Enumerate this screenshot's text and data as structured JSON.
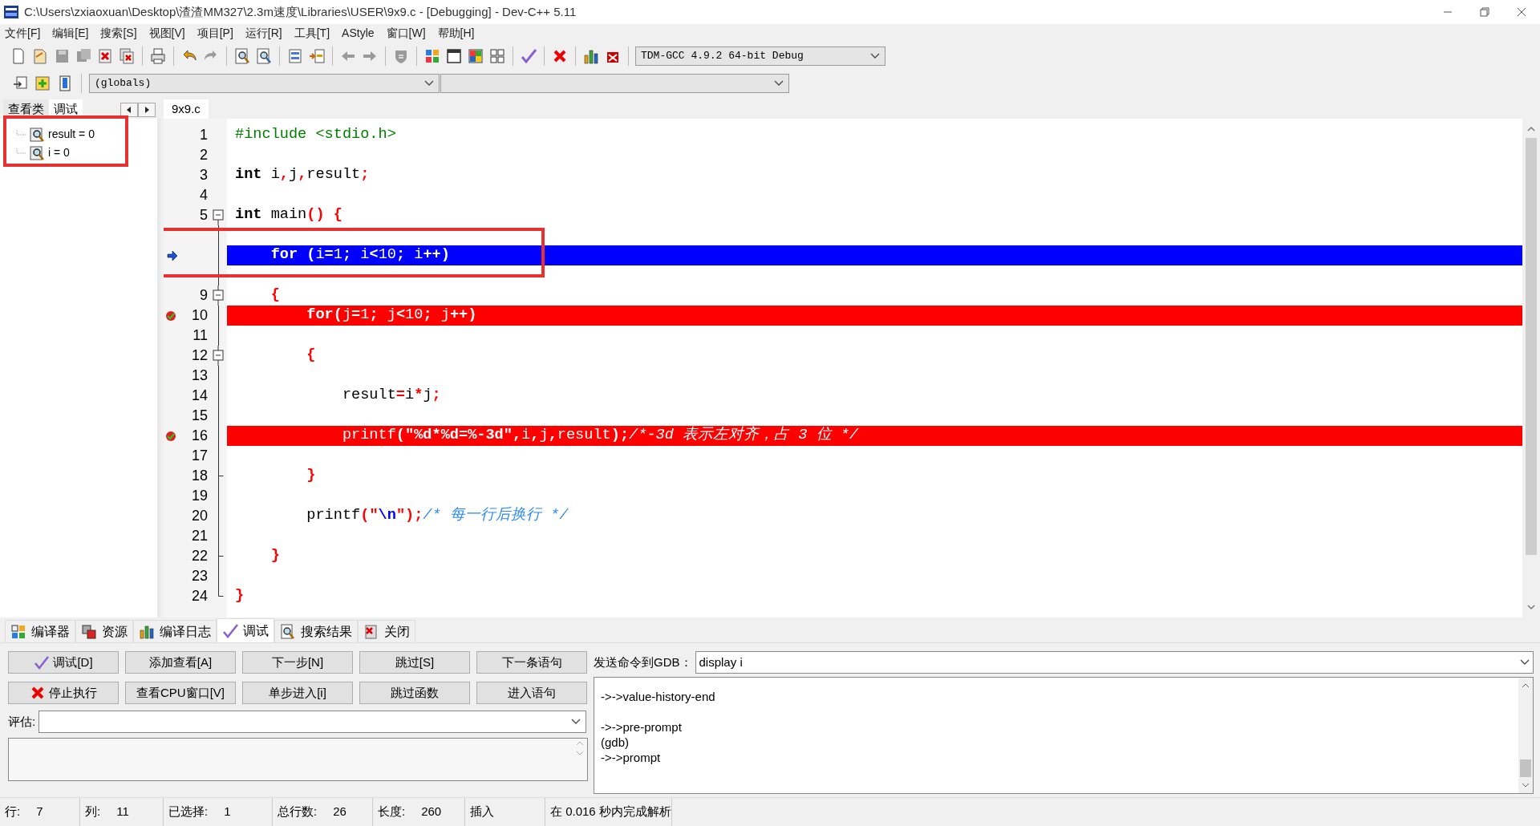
{
  "window": {
    "title": "C:\\Users\\zxiaoxuan\\Desktop\\渣渣MM327\\2.3m速度\\Libraries\\USER\\9x9.c - [Debugging] - Dev-C++ 5.11"
  },
  "menu": [
    "文件[F]",
    "编辑[E]",
    "搜索[S]",
    "视图[V]",
    "项目[P]",
    "运行[R]",
    "工具[T]",
    "AStyle",
    "窗口[W]",
    "帮助[H]"
  ],
  "toolbar": {
    "compiler": "TDM-GCC 4.9.2 64-bit Debug",
    "scope": "(globals)"
  },
  "left_panel": {
    "tabs": [
      {
        "label": "查看类",
        "selected": false
      },
      {
        "label": "调试",
        "selected": true
      }
    ],
    "watches": [
      {
        "text": "result = 0"
      },
      {
        "text": "i = 0"
      }
    ]
  },
  "editor": {
    "tabs": [
      {
        "label": "9x9.c",
        "selected": true
      }
    ],
    "lines": [
      {
        "number": "1",
        "kind": "normal",
        "fold_start": false,
        "fold_end": false,
        "segments": [
          {
            "kind": "pre",
            "text": "#include <stdio.h>"
          }
        ]
      },
      {
        "number": "2",
        "kind": "normal",
        "fold_start": false,
        "fold_end": false
      },
      {
        "number": "3",
        "kind": "normal",
        "fold_start": false,
        "fold_end": false,
        "segments": [
          {
            "kind": "kw",
            "text": "int"
          },
          {
            "kind": "plain",
            "text": " i"
          },
          {
            "kind": "sym",
            "text": ","
          },
          {
            "kind": "plain",
            "text": "j"
          },
          {
            "kind": "sym",
            "text": ","
          },
          {
            "kind": "plain",
            "text": "result"
          },
          {
            "kind": "sym",
            "text": ";"
          }
        ]
      },
      {
        "number": "4",
        "kind": "normal",
        "fold_start": false,
        "fold_end": false
      },
      {
        "number": "5",
        "kind": "normal",
        "fold_start": true,
        "fold_end": false,
        "segments": [
          {
            "kind": "kw",
            "text": "int"
          },
          {
            "kind": "plain",
            "text": " main"
          },
          {
            "kind": "sym",
            "text": "()"
          },
          {
            "kind": "sym",
            "text": " {"
          }
        ]
      },
      {
        "kind": "normal",
        "fold_start": false,
        "fold_end": false
      },
      {
        "kind": "current",
        "fold_start": false,
        "fold_end": false,
        "segments": [
          {
            "kind": "kw",
            "text": "    for"
          },
          {
            "kind": "sym",
            "text": " ("
          },
          {
            "kind": "plain",
            "text": "i"
          },
          {
            "kind": "sym",
            "text": "="
          },
          {
            "kind": "plain",
            "text": "1"
          },
          {
            "kind": "sym",
            "text": ";"
          },
          {
            "kind": "plain",
            "text": " i"
          },
          {
            "kind": "sym",
            "text": "<"
          },
          {
            "kind": "plain",
            "text": "10"
          },
          {
            "kind": "sym",
            "text": ";"
          },
          {
            "kind": "plain",
            "text": " i"
          },
          {
            "kind": "sym",
            "text": "++)"
          }
        ]
      },
      {
        "kind": "normal",
        "fold_start": false,
        "fold_end": false
      },
      {
        "number": "9",
        "kind": "normal",
        "fold_start": true,
        "fold_end": false,
        "segments": [
          {
            "kind": "sym",
            "text": "    {"
          }
        ]
      },
      {
        "number": "10",
        "kind": "breakpoint",
        "fold_start": false,
        "fold_end": false,
        "segments": [
          {
            "kind": "kw",
            "text": "        for"
          },
          {
            "kind": "sym",
            "text": "("
          },
          {
            "kind": "plain",
            "text": "j"
          },
          {
            "kind": "sym",
            "text": "="
          },
          {
            "kind": "plain",
            "text": "1"
          },
          {
            "kind": "sym",
            "text": ";"
          },
          {
            "kind": "plain",
            "text": " j"
          },
          {
            "kind": "sym",
            "text": "<"
          },
          {
            "kind": "plain",
            "text": "10"
          },
          {
            "kind": "sym",
            "text": ";"
          },
          {
            "kind": "plain",
            "text": " j"
          },
          {
            "kind": "sym",
            "text": "++)"
          }
        ]
      },
      {
        "number": "11",
        "kind": "normal",
        "fold_start": false,
        "fold_end": false
      },
      {
        "number": "12",
        "kind": "normal",
        "fold_start": true,
        "fold_end": false,
        "segments": [
          {
            "kind": "sym",
            "text": "        {"
          }
        ]
      },
      {
        "number": "13",
        "kind": "normal",
        "fold_start": false,
        "fold_end": false
      },
      {
        "number": "14",
        "kind": "normal",
        "fold_start": false,
        "fold_end": false,
        "segments": [
          {
            "kind": "plain",
            "text": "            result"
          },
          {
            "kind": "sym",
            "text": "="
          },
          {
            "kind": "plain",
            "text": "i"
          },
          {
            "kind": "sym",
            "text": "*"
          },
          {
            "kind": "plain",
            "text": "j"
          },
          {
            "kind": "sym",
            "text": ";"
          }
        ]
      },
      {
        "number": "15",
        "kind": "normal",
        "fold_start": false,
        "fold_end": false
      },
      {
        "number": "16",
        "kind": "breakpoint",
        "fold_start": false,
        "fold_end": false,
        "segments": [
          {
            "kind": "plain",
            "text": "            printf"
          },
          {
            "kind": "sym",
            "text": "("
          },
          {
            "kind": "str",
            "text": "\"%d*%d=%-3d\""
          },
          {
            "kind": "sym",
            "text": ","
          },
          {
            "kind": "plain",
            "text": "i"
          },
          {
            "kind": "sym",
            "text": ","
          },
          {
            "kind": "plain",
            "text": "j"
          },
          {
            "kind": "sym",
            "text": ","
          },
          {
            "kind": "plain",
            "text": "result"
          },
          {
            "kind": "sym",
            "text": ");"
          },
          {
            "kind": "cmt",
            "text": "/*-3d 表示左对齐，占 3 位 */"
          }
        ]
      },
      {
        "number": "17",
        "kind": "normal",
        "fold_start": false,
        "fold_end": false
      },
      {
        "number": "18",
        "kind": "normal",
        "fold_start": false,
        "fold_end": true,
        "segments": [
          {
            "kind": "sym",
            "text": "        }"
          }
        ]
      },
      {
        "number": "19",
        "kind": "normal",
        "fold_start": false,
        "fold_end": false
      },
      {
        "number": "20",
        "kind": "normal",
        "fold_start": false,
        "fold_end": false,
        "segments": [
          {
            "kind": "plain",
            "text": "        printf"
          },
          {
            "kind": "sym",
            "text": "(\""
          },
          {
            "kind": "esc",
            "text": "\\n"
          },
          {
            "kind": "sym",
            "text": "\");"
          },
          {
            "kind": "cmt",
            "text": "/* 每一行后换行 */"
          }
        ]
      },
      {
        "number": "21",
        "kind": "normal",
        "fold_start": false,
        "fold_end": false
      },
      {
        "number": "22",
        "kind": "normal",
        "fold_start": false,
        "fold_end": true,
        "segments": [
          {
            "kind": "sym",
            "text": "    }"
          }
        ]
      },
      {
        "number": "23",
        "kind": "normal",
        "fold_start": false,
        "fold_end": false
      },
      {
        "number": "24",
        "kind": "normal",
        "fold_start": false,
        "fold_end": true,
        "segments": [
          {
            "kind": "sym",
            "text": "}"
          }
        ]
      }
    ]
  },
  "bottom_tabs": [
    {
      "label": "编译器",
      "selected": false
    },
    {
      "label": "资源",
      "selected": false
    },
    {
      "label": "编译日志",
      "selected": false
    },
    {
      "label": "调试",
      "selected": true
    },
    {
      "label": "搜索结果",
      "selected": false
    },
    {
      "label": "关闭",
      "selected": false
    }
  ],
  "debug_buttons": [
    {
      "label": "调试[D]",
      "kind": "debug"
    },
    {
      "label": "添加查看[A]",
      "kind": "plain"
    },
    {
      "label": "下一步[N]",
      "kind": "plain"
    },
    {
      "label": "跳过[S]",
      "kind": "plain"
    },
    {
      "label": "下一条语句",
      "kind": "plain"
    },
    {
      "label": "停止执行",
      "kind": "stop"
    },
    {
      "label": "查看CPU窗口[V]",
      "kind": "plain"
    },
    {
      "label": "单步进入[i]",
      "kind": "plain"
    },
    {
      "label": "跳过函数",
      "kind": "plain"
    },
    {
      "label": "进入语句",
      "kind": "plain"
    }
  ],
  "evaluate": {
    "label": "评估:"
  },
  "gdb": {
    "label": "发送命令到GDB：",
    "value": "display i",
    "output": "->->value-history-end\n\n->->pre-prompt\n(gdb)\n->->prompt"
  },
  "status_bar": [
    {
      "label": "行:",
      "value": "7"
    },
    {
      "label": "列:",
      "value": "11"
    },
    {
      "label": "已选择:",
      "value": "1"
    },
    {
      "label": "总行数:",
      "value": "26"
    },
    {
      "label": "长度:",
      "value": "260"
    },
    {
      "label": "插入"
    },
    {
      "label": "在 0.016 秒内完成解析"
    }
  ]
}
